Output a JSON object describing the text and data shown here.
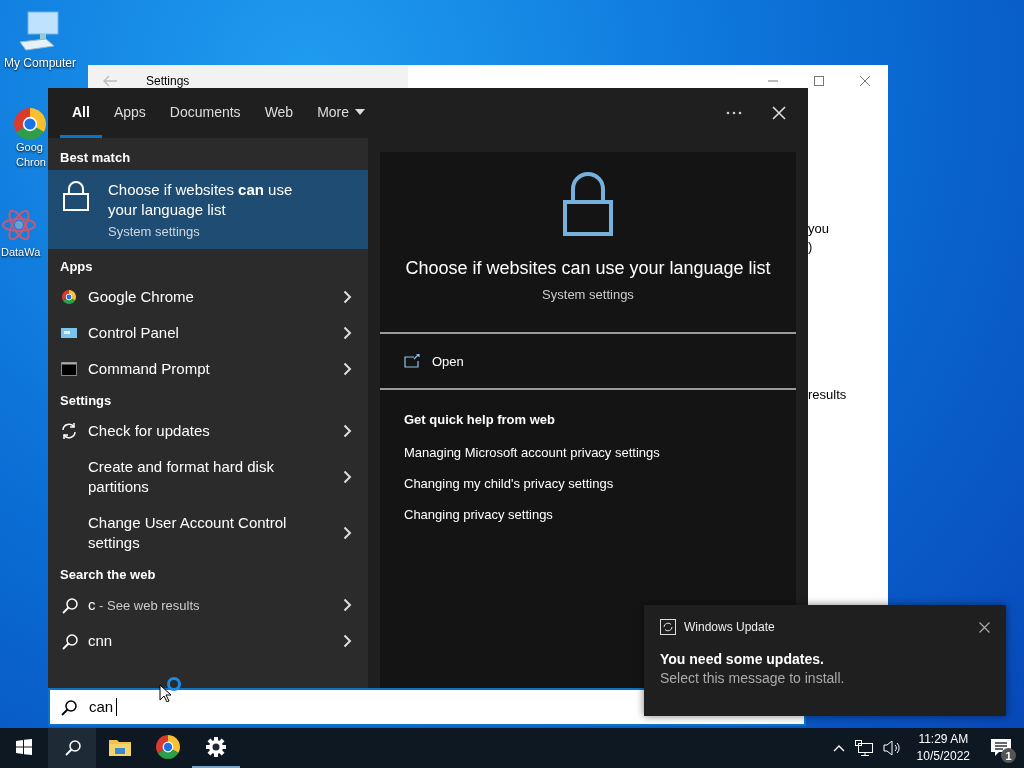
{
  "desktop_icons": [
    {
      "kind": "computer",
      "lines": [
        "My Computer"
      ]
    },
    {
      "kind": "chrome",
      "lines": [
        "Goog",
        "Chron"
      ]
    },
    {
      "kind": "molecule",
      "lines": [
        "DataWa"
      ]
    }
  ],
  "background_window": {
    "title": "Settings",
    "text_fragments": [
      "you",
      ")",
      "results"
    ]
  },
  "search_panel": {
    "tabs": [
      {
        "label": "All",
        "selected": true,
        "dropdown": false
      },
      {
        "label": "Apps",
        "selected": false,
        "dropdown": false
      },
      {
        "label": "Documents",
        "selected": false,
        "dropdown": false
      },
      {
        "label": "Web",
        "selected": false,
        "dropdown": false
      },
      {
        "label": "More",
        "selected": false,
        "dropdown": true
      }
    ],
    "sections": [
      {
        "heading": "Best match",
        "items": [
          {
            "kind": "best",
            "title": "Choose if websites **can** use your language list",
            "subtitle": "System settings",
            "selected": true
          }
        ]
      },
      {
        "heading": "Apps",
        "items": [
          {
            "kind": "chrome",
            "label": "Google Chrome",
            "selected": false
          },
          {
            "kind": "panel",
            "label": "Control Panel",
            "selected": false
          },
          {
            "kind": "prompt",
            "label": "Command Prompt",
            "selected": false
          }
        ]
      },
      {
        "heading": "Settings",
        "items": [
          {
            "kind": "refresh",
            "label": "Check for updates",
            "selected": false
          },
          {
            "kind": "blank",
            "label": "Create and format hard disk partitions",
            "selected": false
          },
          {
            "kind": "blank",
            "label": "Change User Account Control settings",
            "selected": false
          }
        ]
      },
      {
        "heading": "Search the web",
        "items": [
          {
            "kind": "web",
            "label": "c",
            "suffix": " - See web results",
            "selected": false
          },
          {
            "kind": "web",
            "label": "cnn",
            "selected": false
          }
        ]
      }
    ],
    "detail": {
      "title": "Choose if websites can use your language list",
      "subtitle": "System settings",
      "action": "Open",
      "help_heading": "Get quick help from web",
      "links": [
        "Managing Microsoft account privacy settings",
        "Changing my child's privacy settings",
        "Changing privacy settings"
      ]
    },
    "search_box": {
      "value": "can"
    }
  },
  "notification": {
    "app": "Windows Update",
    "title": "You need some updates.",
    "message": "Select this message to install."
  },
  "taskbar": {
    "buttons": [
      {
        "kind": "start",
        "selected": false,
        "running": false
      },
      {
        "kind": "search",
        "selected": true,
        "running": false
      },
      {
        "kind": "folder",
        "selected": false,
        "running": false
      },
      {
        "kind": "chrome",
        "selected": false,
        "running": false
      },
      {
        "kind": "settings",
        "selected": false,
        "running": true
      }
    ],
    "time": "11:29 AM",
    "date": "10/5/2022",
    "notification_count": "1"
  }
}
